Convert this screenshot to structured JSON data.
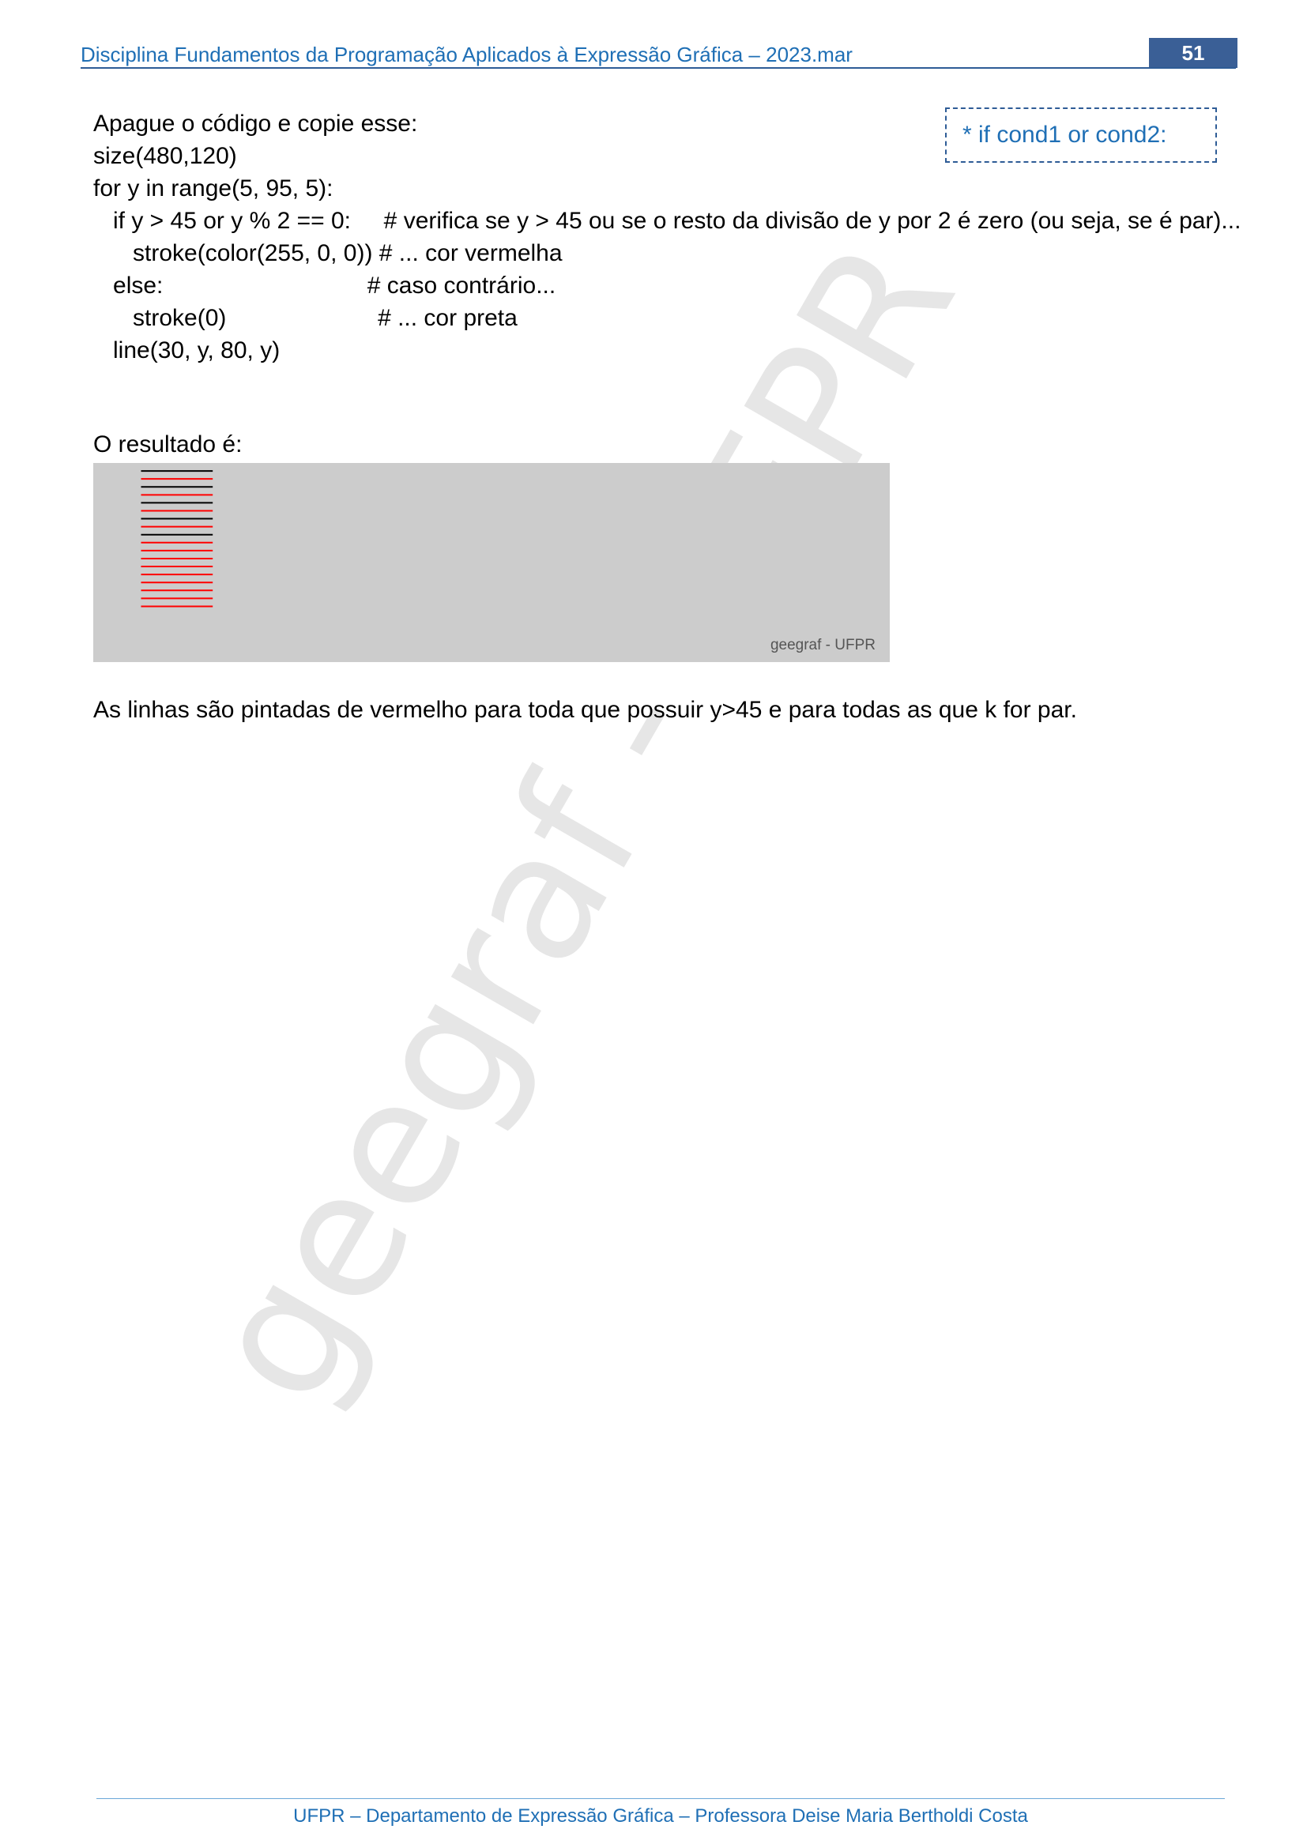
{
  "header": {
    "title": "Disciplina Fundamentos da Programação Aplicados à Expressão Gráfica – 2023.mar",
    "page_number": "51"
  },
  "callout": {
    "text": "* if cond1 or cond2:"
  },
  "code": {
    "intro": "Apague o código e copie esse:",
    "lines": [
      "size(480,120)",
      "for y in range(5, 95, 5):",
      "   if y > 45 or y % 2 == 0:     # verifica se y > 45 ou se o resto da divisão de y por 2 é zero (ou seja, se é par)...",
      "      stroke(color(255, 0, 0)) # ... cor vermelha",
      "   else:                               # caso contrário...",
      "      stroke(0)                       # ... cor preta",
      "   line(30, y, 80, y)"
    ]
  },
  "result": {
    "label": "O resultado é:",
    "canvas_credit": "geegraf - UFPR",
    "canvas_bg": "#cccccc",
    "line_color_red": "#ff0000",
    "line_color_black": "#000000"
  },
  "explanation": "As linhas são pintadas de vermelho para toda que possuir y>45 e para todas as que k for par.",
  "watermark": "geegraf - UFPR",
  "footer": {
    "text": "UFPR – Departamento de Expressão Gráfica – Professora Deise Maria Bertholdi Costa"
  }
}
